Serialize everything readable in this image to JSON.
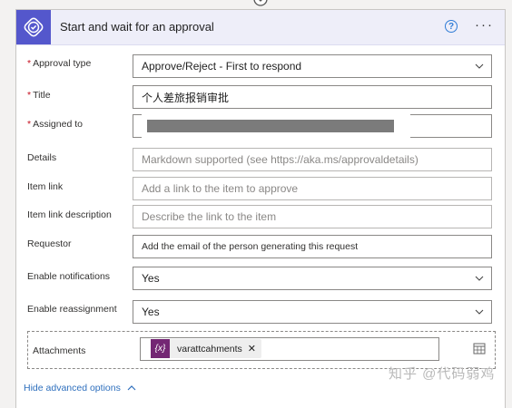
{
  "action": {
    "title": "Start and wait for an approval",
    "help_symbol": "?",
    "more_symbol": "···"
  },
  "fields": {
    "approval_type": {
      "label": "Approval type",
      "required": "*",
      "value": "Approve/Reject - First to respond"
    },
    "title": {
      "label": "Title",
      "required": "*",
      "value": "个人差旅报销审批"
    },
    "assigned_to": {
      "label": "Assigned to",
      "required": "*"
    },
    "details": {
      "label": "Details",
      "placeholder": "Markdown supported (see https://aka.ms/approvaldetails)"
    },
    "item_link": {
      "label": "Item link",
      "placeholder": "Add a link to the item to approve"
    },
    "item_link_description": {
      "label": "Item link description",
      "placeholder": "Describe the link to the item"
    },
    "requestor": {
      "label": "Requestor",
      "placeholder": "Add the email of the person generating this request"
    },
    "enable_notifications": {
      "label": "Enable notifications",
      "value": "Yes"
    },
    "enable_reassignment": {
      "label": "Enable reassignment",
      "value": "Yes"
    },
    "attachments": {
      "label": "Attachments",
      "token_icon": "{x}",
      "token_text": "varattcahments",
      "token_remove": "✕"
    }
  },
  "footer": {
    "hide_advanced": "Hide advanced options"
  },
  "watermark": "知乎 @代码弱鸡",
  "colors": {
    "accent": "#5457cc",
    "header_bg": "#eeeef9",
    "required": "#c50f1f",
    "link": "#2e6fbd",
    "token": "#742774"
  }
}
